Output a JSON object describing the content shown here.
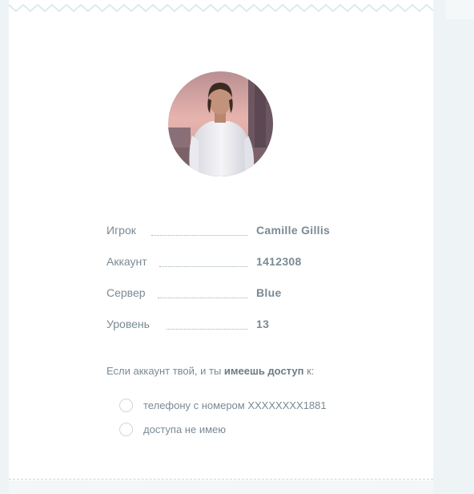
{
  "player": {
    "avatar_alt": "avatar"
  },
  "info": {
    "rows": [
      {
        "label": "Игрок",
        "value": "Camille  Gillis"
      },
      {
        "label": "Аккаунт",
        "value": "1412308"
      },
      {
        "label": "Сервер",
        "value": "Blue"
      },
      {
        "label": "Уровень",
        "value": "13"
      }
    ]
  },
  "question": {
    "prefix": "Если аккаунт твой, и ты ",
    "bold": "имеешь доступ",
    "suffix": " к:"
  },
  "options": [
    {
      "label": "телефону с номером XXXXXXXX1881",
      "selected": false
    },
    {
      "label": "доступа не имею",
      "selected": false
    }
  ],
  "colors": {
    "background": "#eef4f6",
    "card": "#ffffff",
    "text": "#7a8a94",
    "zigzag": "#d8e6ea"
  }
}
